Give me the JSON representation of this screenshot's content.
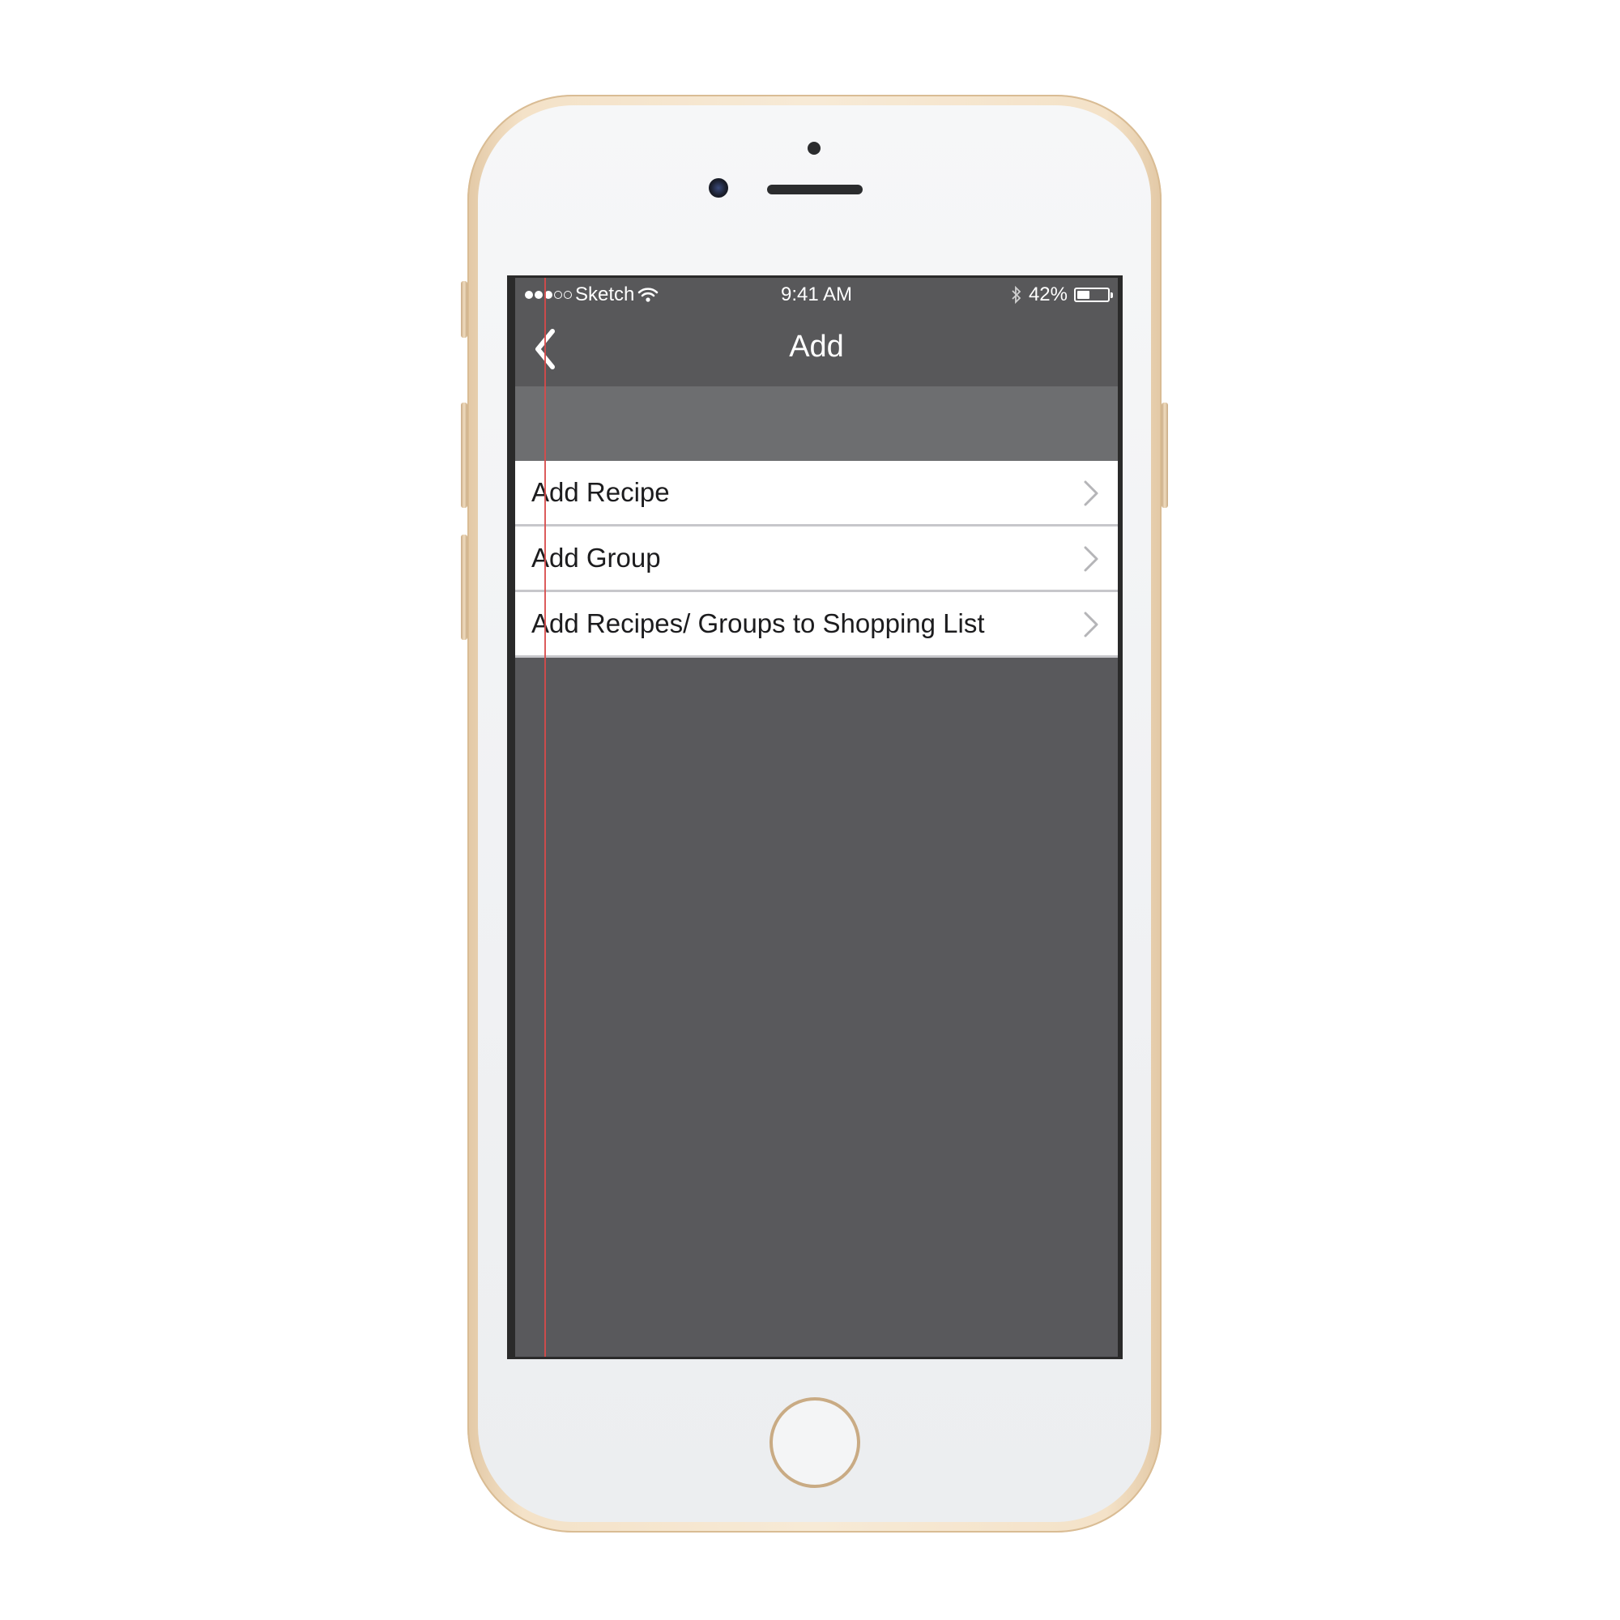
{
  "status_bar": {
    "carrier": "Sketch",
    "time": "9:41 AM",
    "battery_percent_label": "42%",
    "battery_level": 0.42,
    "signal_bars_filled": 3,
    "signal_bars_total": 5
  },
  "nav": {
    "title": "Add",
    "back_icon": "chevron-left-icon"
  },
  "menu": {
    "items": [
      {
        "label": "Add Recipe"
      },
      {
        "label": "Add Group"
      },
      {
        "label": "Add Recipes/ Groups to Shopping List"
      }
    ]
  },
  "colors": {
    "bar": "#58585a",
    "header_band": "#6d6e70",
    "background": "#59595c",
    "row": "#ffffff",
    "guide_line": "#d84a4a",
    "phone_gold": "#e3c9a6"
  }
}
